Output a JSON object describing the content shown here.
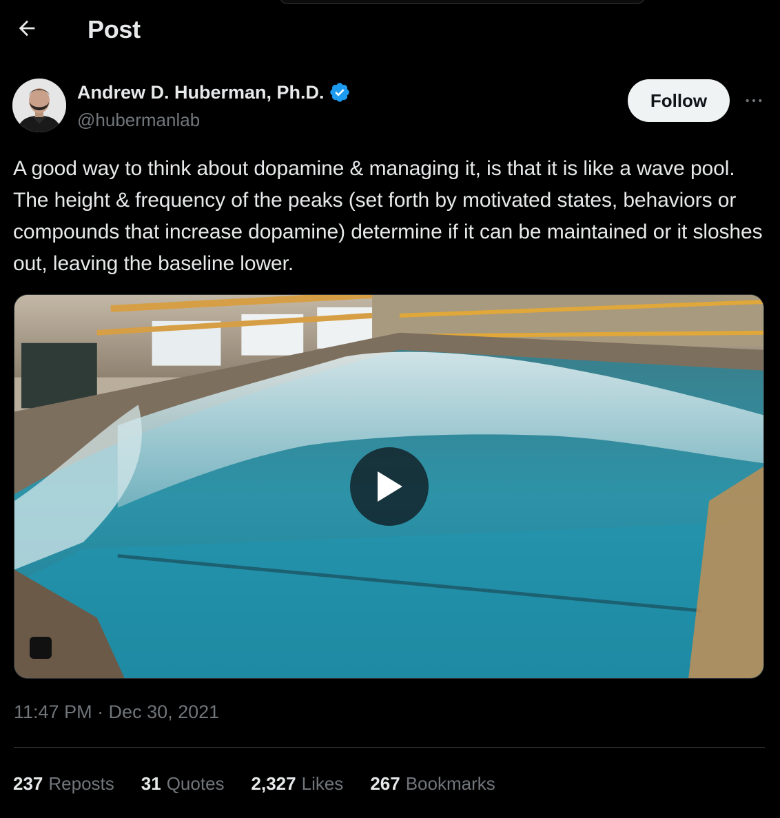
{
  "header": {
    "title": "Post",
    "back_icon": "arrow-left-icon"
  },
  "author": {
    "name": "Andrew D. Huberman, Ph.D.",
    "handle": "@hubermanlab",
    "verified_icon": "verified-badge-icon",
    "follow_label": "Follow",
    "more_icon": "more-options-icon"
  },
  "post": {
    "text": "A good way to think about dopamine & managing it, is that it is like a wave pool. The height & frequency of the peaks (set forth by motivated states, behaviors or compounds that increase dopamine) determine if it can be maintained or it sloshes out, leaving the baseline lower.",
    "timestamp": "11:47 PM · Dec 30, 2021"
  },
  "media": {
    "type": "video",
    "play_icon": "play-icon"
  },
  "stats": [
    {
      "count": "237",
      "label": "Reposts"
    },
    {
      "count": "31",
      "label": "Quotes"
    },
    {
      "count": "2,327",
      "label": "Likes"
    },
    {
      "count": "267",
      "label": "Bookmarks"
    }
  ],
  "colors": {
    "background": "#000000",
    "primary_text": "#e7e9ea",
    "secondary_text": "#71767b",
    "verified_blue": "#1d9bf0",
    "divider": "#2f3336",
    "follow_bg": "#eff3f4"
  }
}
